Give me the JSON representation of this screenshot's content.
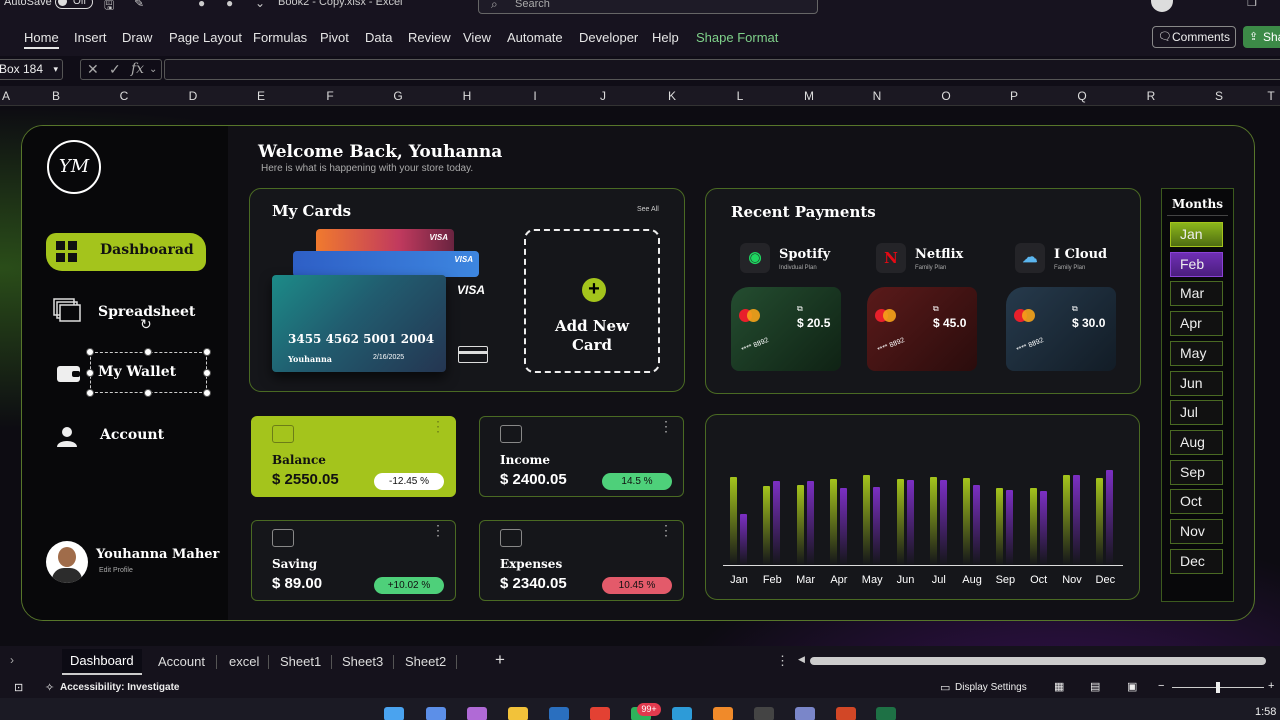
{
  "titlebar": {
    "autosave": "AutoSave",
    "toggle": "Off",
    "doc_title": "Book2 - Copy.xlsx  -  Excel",
    "search_placeholder": "Search"
  },
  "ribbon": {
    "tabs": [
      "Home",
      "Insert",
      "Draw",
      "Page Layout",
      "Formulas",
      "Pivot",
      "Data",
      "Review",
      "View",
      "Automate",
      "Developer",
      "Help",
      "Shape Format"
    ],
    "comments": "Comments",
    "share": "Sha"
  },
  "formula": {
    "namebox": "Box 184",
    "fx": "fx"
  },
  "columns": [
    "A",
    "B",
    "C",
    "D",
    "E",
    "F",
    "G",
    "H",
    "I",
    "J",
    "K",
    "L",
    "M",
    "N",
    "O",
    "P",
    "Q",
    "R",
    "S",
    "T"
  ],
  "dashboard": {
    "logo": "YM",
    "nav": [
      "Dashboarad",
      "Spreadsheet",
      "My Wallet",
      "Account"
    ],
    "profile": {
      "name": "Youhanna Maher",
      "edit": "Edit Profile"
    },
    "welcome": "Welcome Back, Youhanna",
    "welcome_sub": "Here is what is happening with your store today.",
    "my_cards": {
      "title": "My Cards",
      "see_all": "See All",
      "card_number": "3455 4562 5001 2004",
      "holder": "Youhanna",
      "expiry": "2/16/2025",
      "brand": "VISA",
      "add_card": "Add New Card"
    },
    "recent_payments": {
      "title": "Recent Payments",
      "items": [
        {
          "name": "Spotify",
          "plan": "Indivdual Plan",
          "amount": "$ 20.5",
          "last4": "**** 8892"
        },
        {
          "name": "Netflix",
          "plan": "Family Plan",
          "amount": "$ 45.0",
          "last4": "**** 8892"
        },
        {
          "name": "I Cloud",
          "plan": "Family Plan",
          "amount": "$ 30.0",
          "last4": "**** 8892"
        }
      ]
    },
    "stats": [
      {
        "label": "Balance",
        "value": "$ 2550.05",
        "change": "-12.45 %",
        "color": "#ffffff"
      },
      {
        "label": "Income",
        "value": "$ 2400.05",
        "change": "14.5 %",
        "color": "#4ed07a"
      },
      {
        "label": "Saving",
        "value": "$ 89.00",
        "change": "+10.02 %",
        "color": "#4ed07a"
      },
      {
        "label": "Expenses",
        "value": "$ 2340.05",
        "change": "10.45 %",
        "color": "#e35a6a"
      }
    ],
    "months_title": "Months",
    "months": [
      "Jan",
      "Feb",
      "Mar",
      "Apr",
      "May",
      "Jun",
      "Jul",
      "Aug",
      "Sep",
      "Oct",
      "Nov",
      "Dec"
    ],
    "months_selected": [
      "Jan",
      "Feb"
    ]
  },
  "chart_data": {
    "type": "bar",
    "categories": [
      "Jan",
      "Feb",
      "Mar",
      "Apr",
      "May",
      "Jun",
      "Jul",
      "Aug",
      "Sep",
      "Oct",
      "Nov",
      "Dec"
    ],
    "series": [
      {
        "values": [
          80,
          72,
          73,
          78,
          82,
          78,
          80,
          79,
          70,
          70,
          82,
          79
        ],
        "color": "#a4c41c"
      },
      {
        "values": [
          46,
          76,
          76,
          70,
          71,
          77,
          77,
          73,
          68,
          67,
          82,
          86
        ],
        "color": "#7c2fc4"
      }
    ],
    "ylim": [
      0,
      100
    ],
    "grid": false,
    "legend": "none"
  },
  "sheet_tabs": [
    "Dashboard",
    "Account",
    "excel",
    "Sheet1",
    "Sheet3",
    "Sheet2"
  ],
  "status": {
    "accessibility": "Accessibility: Investigate",
    "display": "Display Settings"
  },
  "taskbar": {
    "badge": "99+",
    "clock": "1:58"
  }
}
